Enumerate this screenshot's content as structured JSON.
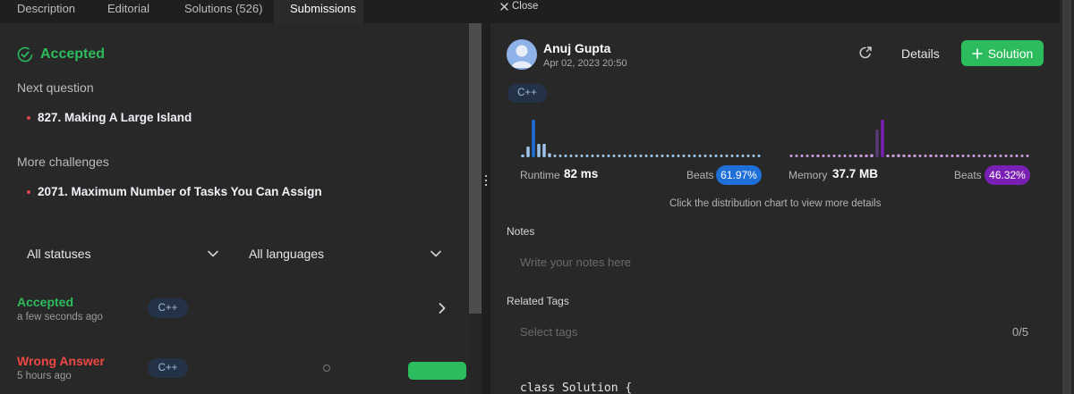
{
  "tabs": [
    {
      "label": "Description"
    },
    {
      "label": "Editorial"
    },
    {
      "label": "Solutions (526)"
    },
    {
      "label": "Submissions"
    }
  ],
  "result": {
    "status": "Accepted",
    "status_color": "#2cbb5d"
  },
  "next_question": {
    "label": "Next question",
    "item": "827. Making A Large Island"
  },
  "more_challenges": {
    "label": "More challenges",
    "item": "2071. Maximum Number of Tasks You Can Assign"
  },
  "filters": {
    "status": "All statuses",
    "language": "All languages"
  },
  "submissions": [
    {
      "status": "Accepted",
      "color": "#2cbb5d",
      "time": "a few seconds ago",
      "language": "C++"
    },
    {
      "status": "Wrong Answer",
      "color": "#ef4743",
      "time": "5 hours ago",
      "language": "C++"
    }
  ],
  "detail": {
    "close_label": "Close",
    "user_name": "Anuj Gupta",
    "date": "Apr 02, 2023 20:50",
    "details_label": "Details",
    "solution_label": "Solution",
    "language": "C++",
    "runtime": {
      "label": "Runtime",
      "value": "82 ms",
      "beats_label": "Beats",
      "beats": "61.97%",
      "color": "#1f6fd8",
      "distribution": [
        2,
        8,
        28,
        10,
        10,
        3,
        1,
        1,
        1,
        1,
        1,
        1,
        1,
        1,
        1,
        1,
        1,
        1,
        1,
        1,
        1,
        1,
        1,
        1,
        1,
        1,
        1,
        1,
        1,
        1,
        1,
        1,
        1,
        1,
        1,
        1,
        1,
        1,
        1,
        1,
        1,
        1,
        1,
        1,
        1
      ],
      "highlight": 2
    },
    "memory": {
      "label": "Memory",
      "value": "37.7 MB",
      "beats_label": "Beats",
      "beats": "46.32%",
      "color": "#7a1fb4",
      "distribution": [
        1,
        1,
        1,
        1,
        1,
        2,
        1,
        1,
        1,
        1,
        1,
        1,
        2,
        2,
        2,
        3,
        28,
        38,
        2,
        2,
        3,
        2,
        2,
        2,
        1,
        1,
        2,
        1,
        2,
        1,
        1,
        2,
        1,
        1,
        1,
        1,
        1,
        1,
        1,
        1,
        1,
        1,
        1,
        1,
        1
      ],
      "highlight": 17
    },
    "chart_hint": "Click the distribution chart to view more details",
    "notes": {
      "label": "Notes",
      "placeholder": "Write your notes here"
    },
    "tags": {
      "label": "Related Tags",
      "placeholder": "Select tags",
      "count": "0/5"
    },
    "code_first_line": "class Solution {"
  }
}
